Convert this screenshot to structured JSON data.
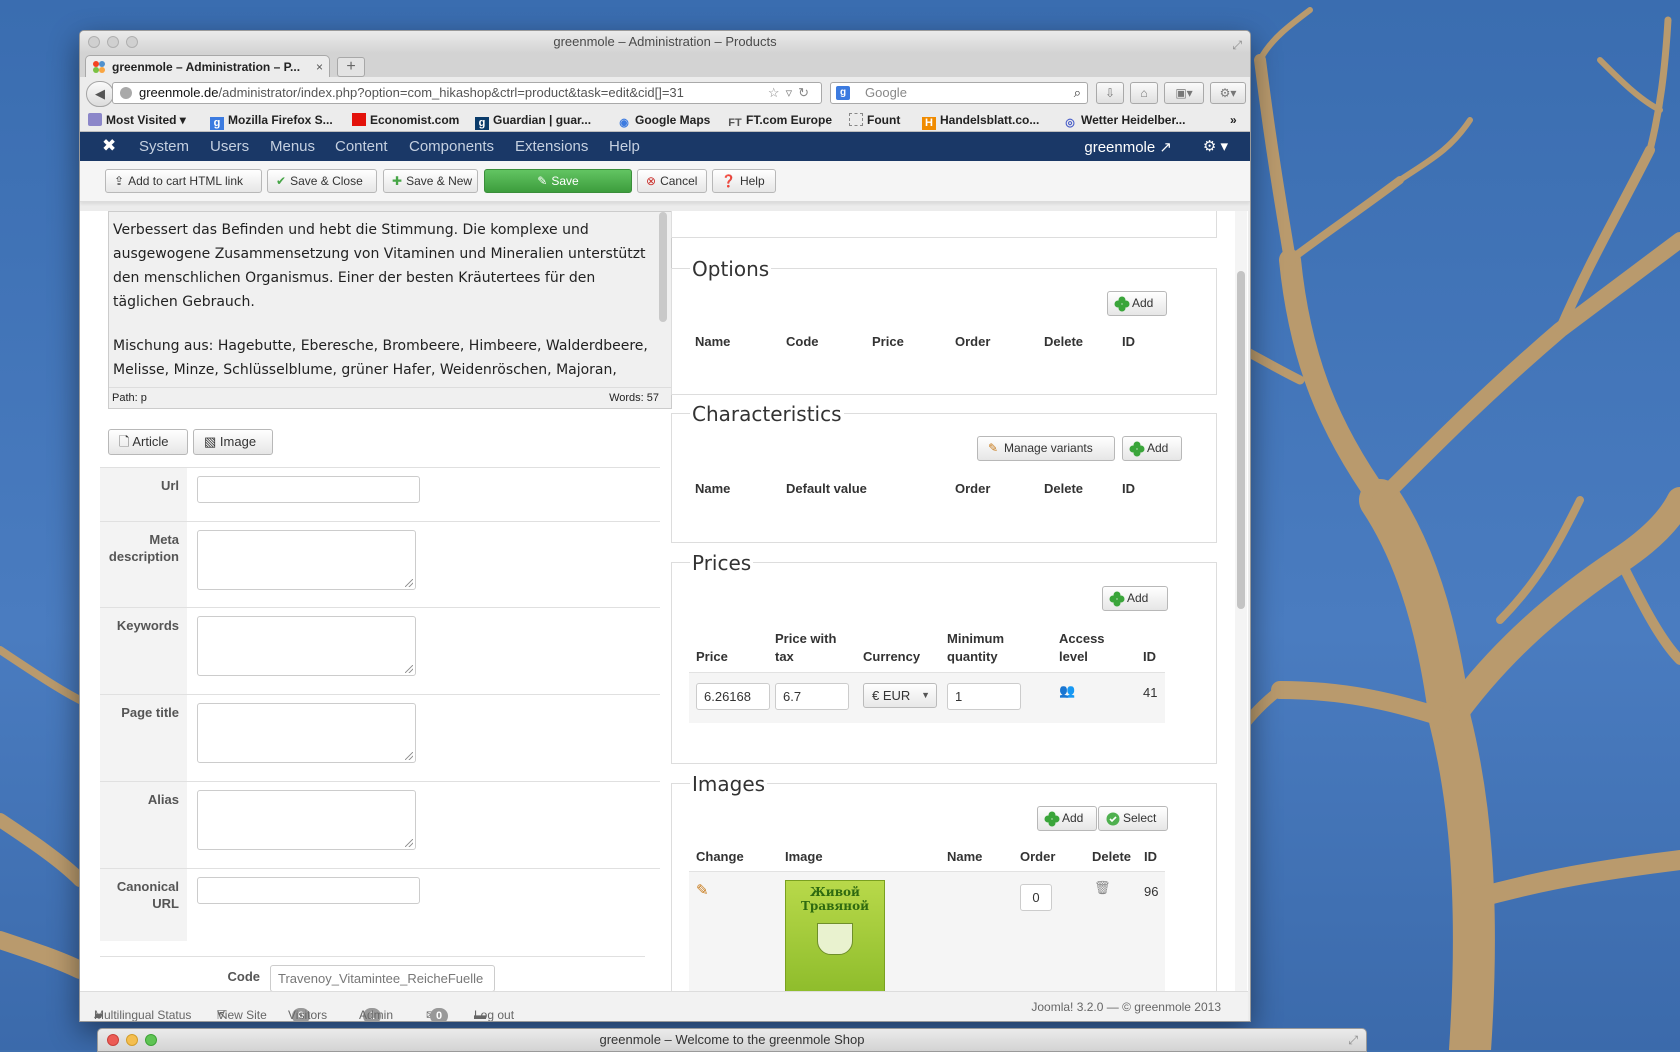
{
  "browser": {
    "window_title": "greenmole – Administration – Products",
    "tab_title": "greenmole – Administration – P...",
    "tab_close": "×",
    "new_tab": "+",
    "url_domain": "greenmole.de",
    "url_path": "/administrator/index.php?option=com_hikashop&ctrl=product&task=edit&cid[]=31",
    "search_placeholder": "Google",
    "bookmarks": [
      "Most Visited",
      "Mozilla Firefox S...",
      "Economist.com",
      "Guardian | guar...",
      "Google Maps",
      "FT.com Europe",
      "Fount",
      "Handelsblatt.co...",
      "Wetter Heidelber..."
    ],
    "bookmarks_more": "»"
  },
  "joomla": {
    "menu": [
      "System",
      "Users",
      "Menus",
      "Content",
      "Components",
      "Extensions",
      "Help"
    ],
    "site_name": "greenmole",
    "toolbar": {
      "add_to_cart": "Add to cart HTML link",
      "save_close": "Save & Close",
      "save_new": "Save & New",
      "save": "Save",
      "cancel": "Cancel",
      "help": "Help"
    }
  },
  "editor": {
    "paragraph1": "Verbessert das Befinden und hebt die Stimmung. Die komplexe und ausgewogene Zusammensetzung von Vitaminen und Mineralien unterstützt den menschlichen Organismus. Einer der besten Kräutertees für den täglichen Gebrauch.",
    "paragraph2": "Mischung aus: Hagebutte, Eberesche, Brombeere, Himbeere, Walderdbeere, Melisse, Minze, Schlüsselblume, grüner Hafer, Weidenröschen, Majoran, Kornblume, Johannisbeere, Johanniskraut, Linde,",
    "path": "Path:  p",
    "words": "Words: 57",
    "article_btn": "Article",
    "image_btn": "Image"
  },
  "form": {
    "url_label": "Url",
    "meta_label": "Meta description",
    "keywords_label": "Keywords",
    "page_title_label": "Page title",
    "alias_label": "Alias",
    "canonical_label": "Canonical URL",
    "code_label": "Code",
    "code_value": "Travenoy_Vitamintee_ReicheFuelle"
  },
  "options": {
    "title": "Options",
    "add": "Add",
    "columns": [
      "Name",
      "Code",
      "Price",
      "Order",
      "Delete",
      "ID"
    ]
  },
  "characteristics": {
    "title": "Characteristics",
    "manage_variants": "Manage variants",
    "add": "Add",
    "columns": [
      "Name",
      "Default value",
      "Order",
      "Delete",
      "ID"
    ]
  },
  "prices": {
    "title": "Prices",
    "add": "Add",
    "columns": [
      "Price",
      "Price with tax",
      "Currency",
      "Minimum quantity",
      "Access level",
      "ID"
    ],
    "row": {
      "price": "6.26168",
      "price_with_tax": "6.7",
      "currency": "€ EUR",
      "min_qty": "1",
      "id": "41"
    }
  },
  "images": {
    "title": "Images",
    "add": "Add",
    "select": "Select",
    "columns": [
      "Change",
      "Image",
      "Name",
      "Order",
      "Delete",
      "ID"
    ],
    "row": {
      "order": "0",
      "id": "96",
      "thumb_text": "Живой Травяной"
    }
  },
  "footer": {
    "multilingual": "Multilingual Status",
    "view_site": "View Site",
    "visitors_count": "0",
    "visitors": "Visitors",
    "admin_count": "1",
    "admin": "Admin",
    "messages_count": "0",
    "logout": "Log out",
    "version": "Joomla! 3.2.0  —  © greenmole 2013"
  },
  "second_window_title": "greenmole – Welcome to the greenmole Shop",
  "colors": {
    "joomla_nav": "#1a3867",
    "save_green": "#4cae4c",
    "sky": "#3f6fae"
  }
}
